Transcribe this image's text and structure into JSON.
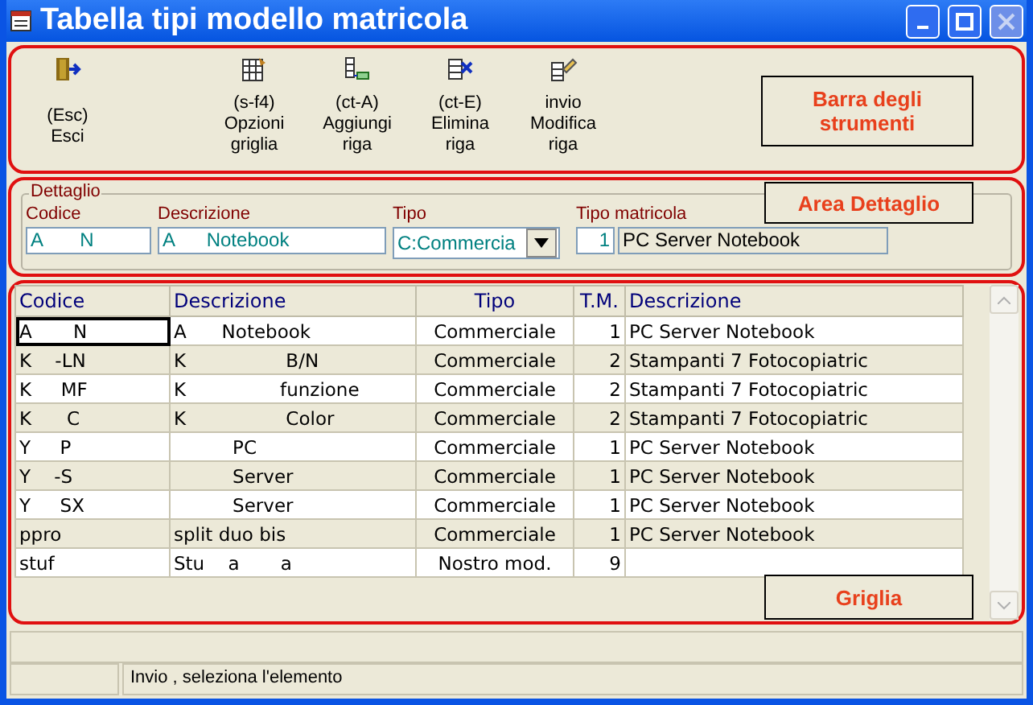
{
  "window": {
    "title": "Tabella tipi modello matricola"
  },
  "toolbar": {
    "items": [
      {
        "kind": "exit",
        "shortcut": "(Esc)",
        "label": "Esci"
      },
      {
        "kind": "options",
        "shortcut": "(s-f4)",
        "label": "Opzioni griglia"
      },
      {
        "kind": "add",
        "shortcut": "(ct-A)",
        "label": "Aggiungi riga"
      },
      {
        "kind": "delete",
        "shortcut": "(ct-E)",
        "label": "Elimina riga"
      },
      {
        "kind": "edit",
        "shortcut": "invio",
        "label": "Modifica riga"
      }
    ],
    "callout": "Barra degli strumenti"
  },
  "detail": {
    "legend": "Dettaglio",
    "callout": "Area Dettaglio",
    "codice": {
      "label": "Codice",
      "value": "A       N"
    },
    "descrizione": {
      "label": "Descrizione",
      "value": "A      Notebook"
    },
    "tipo": {
      "label": "Tipo",
      "value": "C:Commercia"
    },
    "tipo_matricola": {
      "label": "Tipo matricola",
      "number": "1",
      "description": "PC Server Notebook"
    }
  },
  "grid": {
    "callout": "Griglia",
    "columns": [
      "Codice",
      "Descrizione",
      "Tipo",
      "T.M.",
      "Descrizione"
    ],
    "rows": [
      {
        "cells": [
          "A       N",
          "A      Notebook",
          "Commerciale",
          "1",
          "PC Server Notebook"
        ],
        "focused": true
      },
      {
        "cells": [
          "K    -LN",
          "K                 B/N",
          "Commerciale",
          "2",
          "Stampanti 7 Fotocopiatric"
        ],
        "focused": false
      },
      {
        "cells": [
          "K     MF",
          "K                funzione",
          "Commerciale",
          "2",
          "Stampanti 7 Fotocopiatric"
        ],
        "focused": false
      },
      {
        "cells": [
          "K      C",
          "K                 Color",
          "Commerciale",
          "2",
          "Stampanti 7 Fotocopiatric"
        ],
        "focused": false
      },
      {
        "cells": [
          "Y     P",
          "          PC",
          "Commerciale",
          "1",
          "PC Server Notebook"
        ],
        "focused": false
      },
      {
        "cells": [
          "Y    -S",
          "          Server",
          "Commerciale",
          "1",
          "PC Server Notebook"
        ],
        "focused": false
      },
      {
        "cells": [
          "Y     SX",
          "          Server",
          "Commerciale",
          "1",
          "PC Server Notebook"
        ],
        "focused": false
      },
      {
        "cells": [
          "ppro",
          "split duo bis",
          "Commerciale",
          "1",
          "PC Server Notebook"
        ],
        "focused": false
      },
      {
        "cells": [
          "stuf",
          "Stu    a       a",
          "Nostro mod.",
          "9",
          ""
        ],
        "focused": false
      }
    ]
  },
  "status_bar": {
    "message": "Invio , seleziona l'elemento"
  }
}
